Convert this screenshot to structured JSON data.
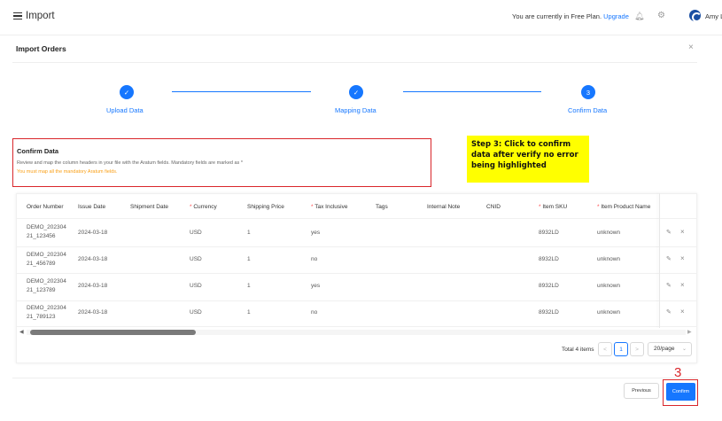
{
  "app": {
    "title": "Import"
  },
  "topbar": {
    "plan_text": "You are currently in Free Plan.",
    "upgrade_label": "Upgrade",
    "user_name": "Amy L"
  },
  "modal": {
    "title": "Import Orders",
    "close": "×"
  },
  "steps": [
    {
      "number": "✓",
      "label": "Upload Data"
    },
    {
      "number": "✓",
      "label": "Mapping Data"
    },
    {
      "number": "3",
      "label": "Confirm Data"
    }
  ],
  "confirm_section": {
    "title": "Confirm Data",
    "description": "Review and map the column headers in your file with the Aratum fields. Mandatory fields are marked as *",
    "warning": "You must map all the mandatory Aratum fields."
  },
  "callout": {
    "text": "Step 3: Click to confirm data after verify no error being highlighted"
  },
  "table": {
    "columns": [
      {
        "label": "Order Number",
        "required": ""
      },
      {
        "label": "Issue Date",
        "required": ""
      },
      {
        "label": "Shipment Date",
        "required": ""
      },
      {
        "label": "Currency",
        "required": "*"
      },
      {
        "label": "Shipping Price",
        "required": ""
      },
      {
        "label": "Tax Inclusive",
        "required": "*"
      },
      {
        "label": "Tags",
        "required": ""
      },
      {
        "label": "Internal Note",
        "required": ""
      },
      {
        "label": "CNID",
        "required": ""
      },
      {
        "label": "Item SKU",
        "required": "*"
      },
      {
        "label": "Item Product Name",
        "required": "*"
      }
    ],
    "rows": [
      {
        "order_line1": "DEMO_202304",
        "order_line2": "21_123456",
        "issue_date": "2024-03-18",
        "currency": "USD",
        "shipping_price": "1",
        "tax_inclusive": "yes",
        "sku": "8932LD",
        "product_name": "unknown"
      },
      {
        "order_line1": "DEMO_202304",
        "order_line2": "21_456789",
        "issue_date": "2024-03-18",
        "currency": "USD",
        "shipping_price": "1",
        "tax_inclusive": "no",
        "sku": "8932LD",
        "product_name": "unknown"
      },
      {
        "order_line1": "DEMO_202304",
        "order_line2": "21_123789",
        "issue_date": "2024-03-18",
        "currency": "USD",
        "shipping_price": "1",
        "tax_inclusive": "yes",
        "sku": "8932LD",
        "product_name": "unknown"
      },
      {
        "order_line1": "DEMO_202304",
        "order_line2": "21_789123",
        "issue_date": "2024-03-18",
        "currency": "USD",
        "shipping_price": "1",
        "tax_inclusive": "no",
        "sku": "8932LD",
        "product_name": "unknown"
      }
    ],
    "edit_icon": "edit-icon",
    "delete_icon": "close-icon"
  },
  "pagination": {
    "total": "Total 4 items",
    "current_page": "1",
    "page_size": "20/page"
  },
  "footer": {
    "previous_label": "Previous",
    "confirm_label": "Confirm",
    "annotation_number": "3"
  },
  "colors": {
    "primary": "#1677ff",
    "annotation_red": "#d9262b",
    "warning": "#fa9f16",
    "callout_bg": "#ffff00"
  }
}
